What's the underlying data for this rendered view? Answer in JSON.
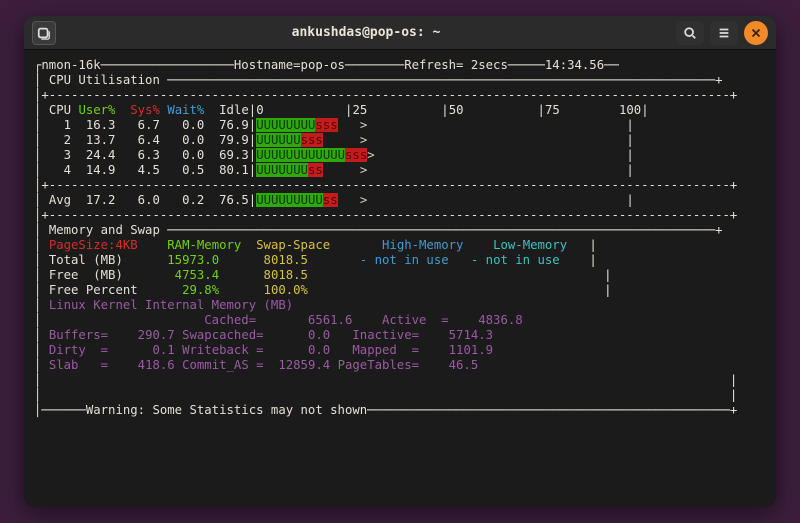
{
  "window": {
    "title": "ankushdas@pop-os: ~"
  },
  "nmon": {
    "name": "nmon-16k",
    "host_label": "Hostname=pop-os",
    "refresh_label": "Refresh= 2secs",
    "time": "14:34.56"
  },
  "cpu": {
    "section": "CPU Utilisation",
    "headers": {
      "cpu": "CPU",
      "user": "User%",
      "sys": "Sys%",
      "wait": "Wait%",
      "idle": "Idle"
    },
    "scale": [
      "0",
      "25",
      "50",
      "75",
      "100"
    ],
    "rows": [
      {
        "id": "1",
        "user": "16.3",
        "sys": "6.7",
        "wait": "0.0",
        "idle": "76.9",
        "u": 8,
        "s": 3
      },
      {
        "id": "2",
        "user": "13.7",
        "sys": "6.4",
        "wait": "0.0",
        "idle": "79.9",
        "u": 6,
        "s": 3
      },
      {
        "id": "3",
        "user": "24.4",
        "sys": "6.3",
        "wait": "0.0",
        "idle": "69.3",
        "u": 12,
        "s": 3
      },
      {
        "id": "4",
        "user": "14.9",
        "sys": "4.5",
        "wait": "0.5",
        "idle": "80.1",
        "u": 7,
        "s": 2
      }
    ],
    "avg": {
      "label": "Avg",
      "user": "17.2",
      "sys": "6.0",
      "wait": "0.2",
      "idle": "76.5",
      "u": 9,
      "s": 2
    }
  },
  "mem": {
    "section": "Memory and Swap",
    "pagesize": "PageSize:4KB",
    "cols": {
      "ram": "RAM-Memory",
      "swap": "Swap-Space",
      "high": "High-Memory",
      "low": "Low-Memory"
    },
    "not_in_use": "- not in use",
    "rows": {
      "total": {
        "label": "Total (MB)",
        "ram": "15973.0",
        "swap": "8018.5"
      },
      "free": {
        "label": "Free  (MB)",
        "ram": "4753.4",
        "swap": "8018.5"
      },
      "freep": {
        "label": "Free Percent",
        "ram": "29.8%",
        "swap": "100.0%"
      }
    },
    "kernel": {
      "title": "Linux Kernel Internal Memory (MB)",
      "items": {
        "cached": {
          "label": "Cached=",
          "val": "6561.6"
        },
        "active": {
          "label": "Active  =",
          "val": "4836.8"
        },
        "buffers": {
          "label": "Buffers=",
          "val": "290.7"
        },
        "swapcached": {
          "label": "Swapcached= ",
          "val": "0.0"
        },
        "inactive": {
          "label": "Inactive=",
          "val": "5714.3"
        },
        "dirty": {
          "label": "Dirty  =",
          "val": "0.1"
        },
        "writeback": {
          "label": "Writeback =",
          "val": "0.0"
        },
        "mapped": {
          "label": "Mapped  =",
          "val": "1101.9"
        },
        "slab": {
          "label": "Slab   =",
          "val": "418.6"
        },
        "commitas": {
          "label": "Commit_AS =",
          "val": "12859.4"
        },
        "pagetables": {
          "label": "PageTables=",
          "val": "46.5"
        }
      }
    }
  },
  "footer": {
    "warning": "Warning: Some Statistics may not shown"
  }
}
